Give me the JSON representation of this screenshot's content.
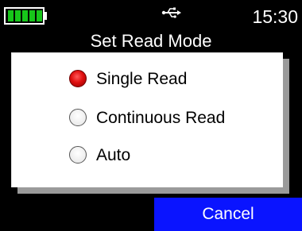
{
  "status": {
    "battery_icon": "battery-full-icon",
    "battery_color": "#17c61a",
    "usb_icon": "usb-icon",
    "time": "15:30"
  },
  "title": "Set Read Mode",
  "options": [
    {
      "label": "Single Read",
      "selected": true
    },
    {
      "label": "Continuous Read",
      "selected": false
    },
    {
      "label": "Auto",
      "selected": false
    }
  ],
  "cancel_label": "Cancel",
  "colors": {
    "background": "#000000",
    "dialog": "#ffffff",
    "dialog_shadow": "#9a9a9a",
    "selected_radio": "#e01010",
    "cancel_button": "#0a14ff"
  }
}
